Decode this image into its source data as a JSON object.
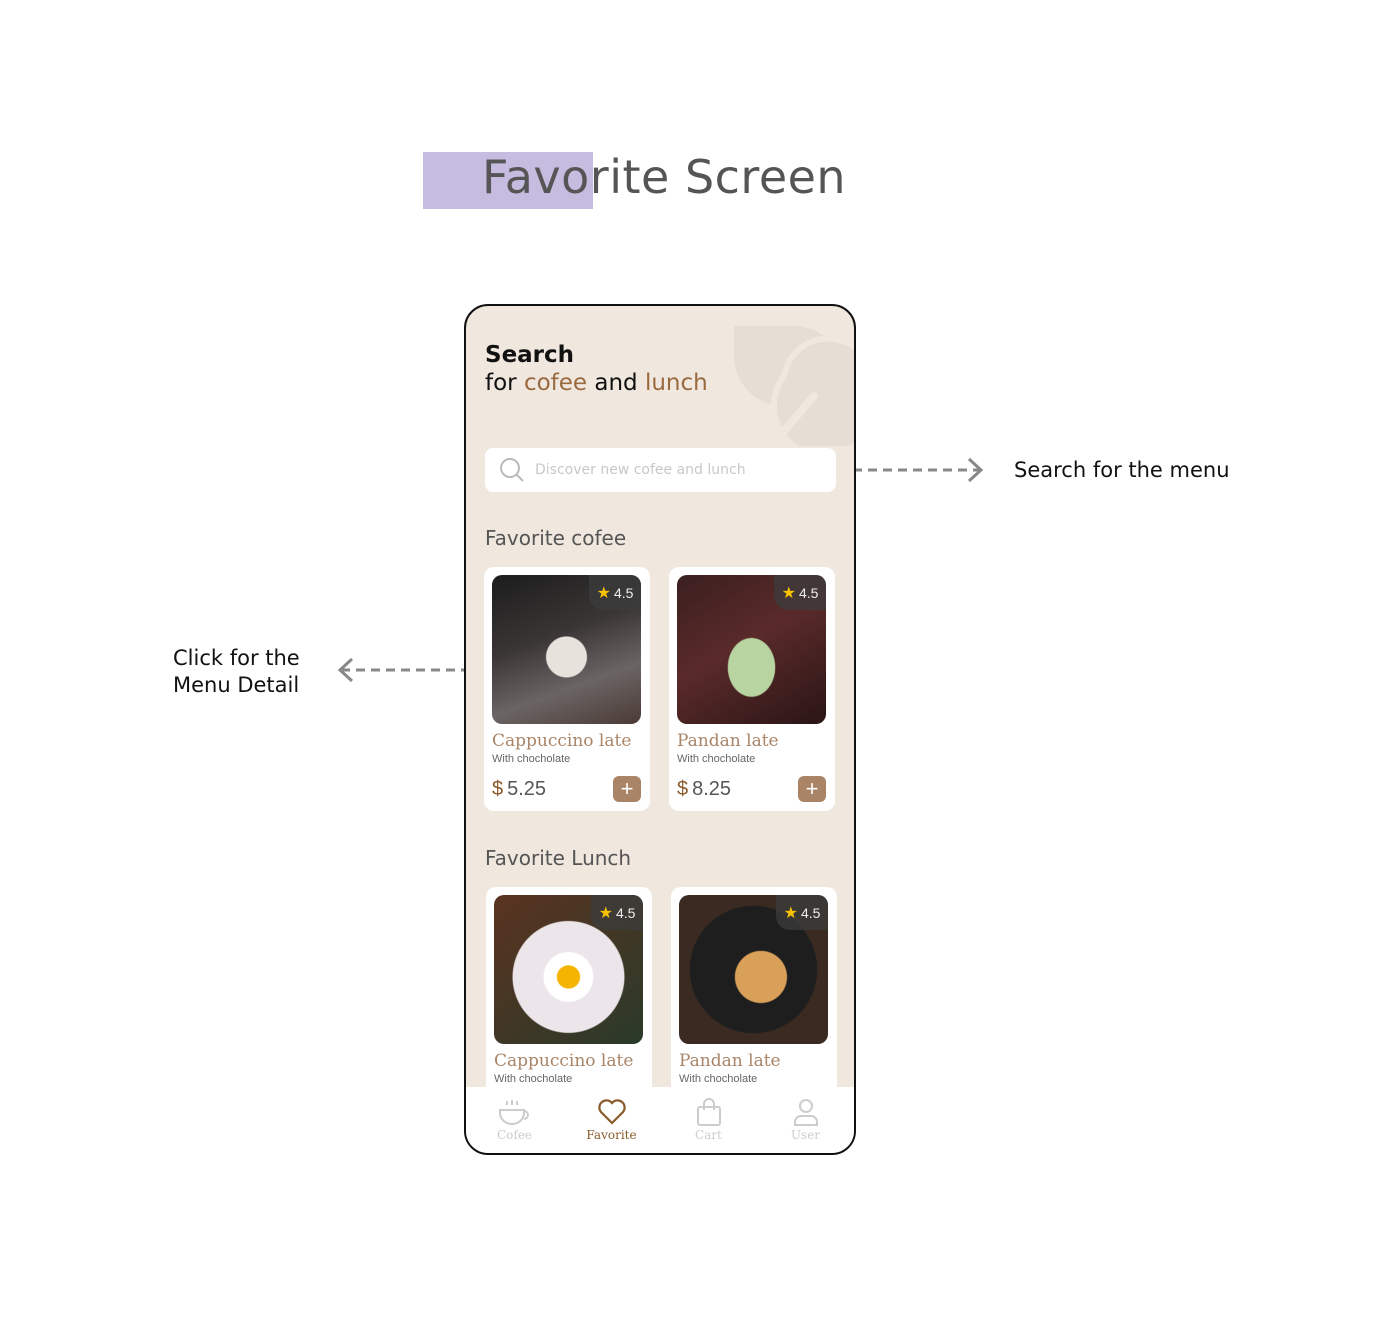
{
  "page": {
    "title": "Favorite Screen"
  },
  "annotations": {
    "search": "Search for the menu",
    "detail_line1": "Click for the",
    "detail_line2": "Menu Detail"
  },
  "header": {
    "line1": "Search",
    "for": "for",
    "word1": "cofee",
    "and": "and",
    "word2": "lunch"
  },
  "search": {
    "placeholder": "Discover new cofee and lunch"
  },
  "sections": {
    "coffee": "Favorite cofee",
    "lunch": "Favorite Lunch"
  },
  "coffee": [
    {
      "name": "Cappuccino late",
      "sub": "With chocholate",
      "currency": "$",
      "price": "5.25",
      "rating": "4.5"
    },
    {
      "name": "Pandan late",
      "sub": "With chocholate",
      "currency": "$",
      "price": "8.25",
      "rating": "4.5"
    }
  ],
  "lunch": [
    {
      "name": "Cappuccino late",
      "sub": "With chocholate",
      "rating": "4.5"
    },
    {
      "name": "Pandan late",
      "sub": "With chocholate",
      "rating": "4.5"
    }
  ],
  "nav": [
    {
      "label": "Cofee"
    },
    {
      "label": "Favorite"
    },
    {
      "label": "Cart"
    },
    {
      "label": "User"
    }
  ],
  "colors": {
    "accent": "#a98467",
    "bg": "#f0e7df",
    "highlight": "#c6bce0"
  }
}
